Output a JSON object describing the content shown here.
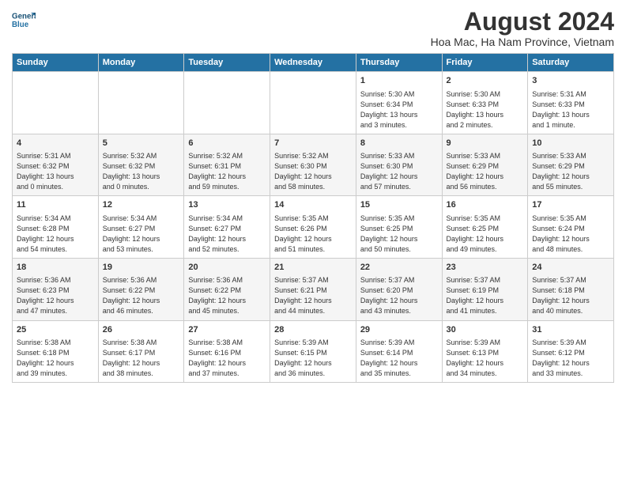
{
  "header": {
    "logo_line1": "General",
    "logo_line2": "Blue",
    "title": "August 2024",
    "subtitle": "Hoa Mac, Ha Nam Province, Vietnam"
  },
  "calendar": {
    "days_of_week": [
      "Sunday",
      "Monday",
      "Tuesday",
      "Wednesday",
      "Thursday",
      "Friday",
      "Saturday"
    ],
    "weeks": [
      [
        {
          "day": "",
          "content": ""
        },
        {
          "day": "",
          "content": ""
        },
        {
          "day": "",
          "content": ""
        },
        {
          "day": "",
          "content": ""
        },
        {
          "day": "1",
          "content": "Sunrise: 5:30 AM\nSunset: 6:34 PM\nDaylight: 13 hours\nand 3 minutes."
        },
        {
          "day": "2",
          "content": "Sunrise: 5:30 AM\nSunset: 6:33 PM\nDaylight: 13 hours\nand 2 minutes."
        },
        {
          "day": "3",
          "content": "Sunrise: 5:31 AM\nSunset: 6:33 PM\nDaylight: 13 hours\nand 1 minute."
        }
      ],
      [
        {
          "day": "4",
          "content": "Sunrise: 5:31 AM\nSunset: 6:32 PM\nDaylight: 13 hours\nand 0 minutes."
        },
        {
          "day": "5",
          "content": "Sunrise: 5:32 AM\nSunset: 6:32 PM\nDaylight: 13 hours\nand 0 minutes."
        },
        {
          "day": "6",
          "content": "Sunrise: 5:32 AM\nSunset: 6:31 PM\nDaylight: 12 hours\nand 59 minutes."
        },
        {
          "day": "7",
          "content": "Sunrise: 5:32 AM\nSunset: 6:30 PM\nDaylight: 12 hours\nand 58 minutes."
        },
        {
          "day": "8",
          "content": "Sunrise: 5:33 AM\nSunset: 6:30 PM\nDaylight: 12 hours\nand 57 minutes."
        },
        {
          "day": "9",
          "content": "Sunrise: 5:33 AM\nSunset: 6:29 PM\nDaylight: 12 hours\nand 56 minutes."
        },
        {
          "day": "10",
          "content": "Sunrise: 5:33 AM\nSunset: 6:29 PM\nDaylight: 12 hours\nand 55 minutes."
        }
      ],
      [
        {
          "day": "11",
          "content": "Sunrise: 5:34 AM\nSunset: 6:28 PM\nDaylight: 12 hours\nand 54 minutes."
        },
        {
          "day": "12",
          "content": "Sunrise: 5:34 AM\nSunset: 6:27 PM\nDaylight: 12 hours\nand 53 minutes."
        },
        {
          "day": "13",
          "content": "Sunrise: 5:34 AM\nSunset: 6:27 PM\nDaylight: 12 hours\nand 52 minutes."
        },
        {
          "day": "14",
          "content": "Sunrise: 5:35 AM\nSunset: 6:26 PM\nDaylight: 12 hours\nand 51 minutes."
        },
        {
          "day": "15",
          "content": "Sunrise: 5:35 AM\nSunset: 6:25 PM\nDaylight: 12 hours\nand 50 minutes."
        },
        {
          "day": "16",
          "content": "Sunrise: 5:35 AM\nSunset: 6:25 PM\nDaylight: 12 hours\nand 49 minutes."
        },
        {
          "day": "17",
          "content": "Sunrise: 5:35 AM\nSunset: 6:24 PM\nDaylight: 12 hours\nand 48 minutes."
        }
      ],
      [
        {
          "day": "18",
          "content": "Sunrise: 5:36 AM\nSunset: 6:23 PM\nDaylight: 12 hours\nand 47 minutes."
        },
        {
          "day": "19",
          "content": "Sunrise: 5:36 AM\nSunset: 6:22 PM\nDaylight: 12 hours\nand 46 minutes."
        },
        {
          "day": "20",
          "content": "Sunrise: 5:36 AM\nSunset: 6:22 PM\nDaylight: 12 hours\nand 45 minutes."
        },
        {
          "day": "21",
          "content": "Sunrise: 5:37 AM\nSunset: 6:21 PM\nDaylight: 12 hours\nand 44 minutes."
        },
        {
          "day": "22",
          "content": "Sunrise: 5:37 AM\nSunset: 6:20 PM\nDaylight: 12 hours\nand 43 minutes."
        },
        {
          "day": "23",
          "content": "Sunrise: 5:37 AM\nSunset: 6:19 PM\nDaylight: 12 hours\nand 41 minutes."
        },
        {
          "day": "24",
          "content": "Sunrise: 5:37 AM\nSunset: 6:18 PM\nDaylight: 12 hours\nand 40 minutes."
        }
      ],
      [
        {
          "day": "25",
          "content": "Sunrise: 5:38 AM\nSunset: 6:18 PM\nDaylight: 12 hours\nand 39 minutes."
        },
        {
          "day": "26",
          "content": "Sunrise: 5:38 AM\nSunset: 6:17 PM\nDaylight: 12 hours\nand 38 minutes."
        },
        {
          "day": "27",
          "content": "Sunrise: 5:38 AM\nSunset: 6:16 PM\nDaylight: 12 hours\nand 37 minutes."
        },
        {
          "day": "28",
          "content": "Sunrise: 5:39 AM\nSunset: 6:15 PM\nDaylight: 12 hours\nand 36 minutes."
        },
        {
          "day": "29",
          "content": "Sunrise: 5:39 AM\nSunset: 6:14 PM\nDaylight: 12 hours\nand 35 minutes."
        },
        {
          "day": "30",
          "content": "Sunrise: 5:39 AM\nSunset: 6:13 PM\nDaylight: 12 hours\nand 34 minutes."
        },
        {
          "day": "31",
          "content": "Sunrise: 5:39 AM\nSunset: 6:12 PM\nDaylight: 12 hours\nand 33 minutes."
        }
      ]
    ]
  }
}
